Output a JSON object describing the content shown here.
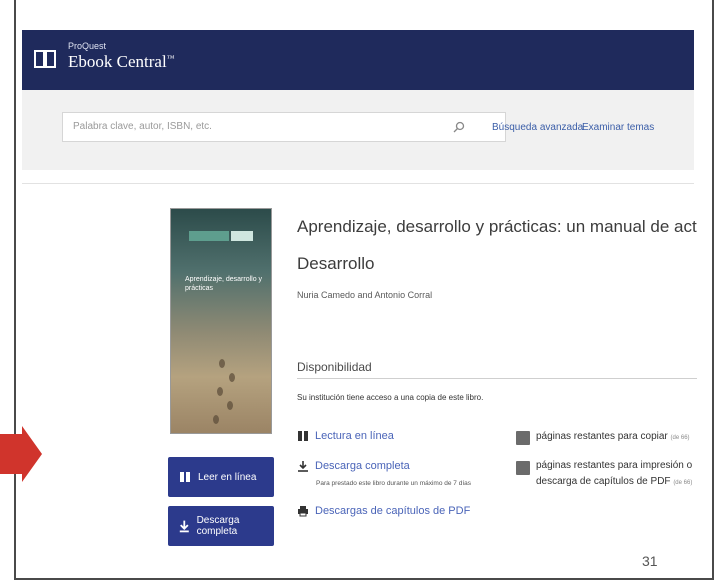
{
  "header": {
    "brand_small": "ProQuest",
    "brand_name": "Ebook Central",
    "brand_mark": "™"
  },
  "search": {
    "placeholder": "Palabra clave, autor, ISBN, etc.",
    "advanced_link": "Búsqueda avanzada",
    "browse_link": "Examinar temas"
  },
  "book": {
    "title": "Aprendizaje, desarrollo y prácticas: un manual de actividades prác",
    "subtitle": "Desarrollo",
    "authors": "Nuria Camedo and Antonio Corral",
    "cover_text": "Aprendizaje, desarrollo y prácticas"
  },
  "availability": {
    "heading": "Disponibilidad",
    "access_text": "Su institución tiene acceso a una copia de este libro.",
    "options": {
      "read_online": "Lectura en línea",
      "full_download": "Descarga completa",
      "full_download_note": "Para prestado este libro durante un máximo de 7 días",
      "chapter_download": "Descargas de capítulos de PDF"
    },
    "copy_pages": "páginas restantes para copiar",
    "copy_pages_note": "(de 66)",
    "print_pages": "páginas restantes para impresión o",
    "print_pages_2": "descarga de capítulos de PDF",
    "print_pages_note": "(de 66)"
  },
  "buttons": {
    "read_online": "Leer en línea",
    "full_download": "Descarga completa"
  },
  "page_number": "31",
  "colors": {
    "header_bg": "#1f2a5c",
    "button_bg": "#2c3a8c",
    "link": "#4a64b8",
    "arrow": "#d0342c"
  }
}
